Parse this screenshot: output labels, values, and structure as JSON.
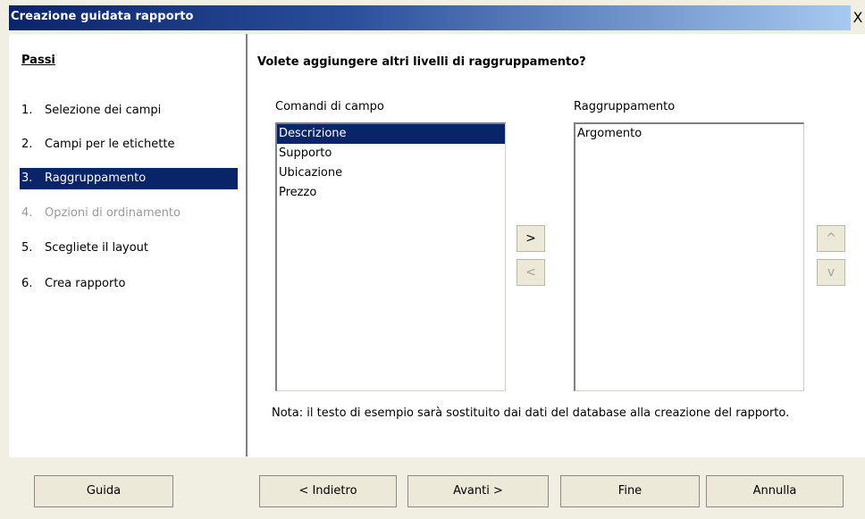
{
  "window": {
    "title": "Creazione guidata rapporto",
    "close_label": "X"
  },
  "steps": {
    "title": "Passi",
    "items": [
      {
        "num": "1.",
        "label": "Selezione dei campi"
      },
      {
        "num": "2.",
        "label": "Campi per le etichette"
      },
      {
        "num": "3.",
        "label": "Raggruppamento"
      },
      {
        "num": "4.",
        "label": "Opzioni di ordinamento"
      },
      {
        "num": "5.",
        "label": "Scegliete il layout"
      },
      {
        "num": "6.",
        "label": "Crea rapporto"
      }
    ]
  },
  "main": {
    "question": "Volete aggiungere altri livelli di raggruppamento?",
    "fields_label": "Comandi di campo",
    "fields": [
      "Descrizione",
      "Supporto",
      "Ubicazione",
      "Prezzo"
    ],
    "grouping_label": "Raggruppamento",
    "grouping": [
      "Argomento"
    ],
    "add_label": ">",
    "remove_label": "<",
    "up_label": "^",
    "down_label": "v",
    "note": "Nota: il testo di esempio sarà sostituito dai dati del database alla creazione del rapporto."
  },
  "buttons": {
    "help": "Guida",
    "back": "< Indietro",
    "next": "Avanti >",
    "finish": "Fine",
    "cancel": "Annulla"
  }
}
